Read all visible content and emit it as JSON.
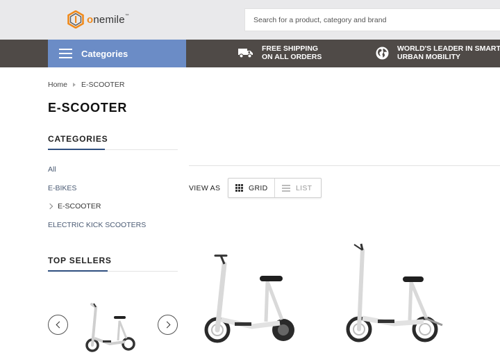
{
  "header": {
    "logo": {
      "text_before": "",
      "o": "o",
      "text_after": "nemile",
      "tm": "™"
    },
    "search": {
      "placeholder": "Search for a product, category and brand",
      "value": ""
    }
  },
  "nav": {
    "categories_label": "Categories",
    "promos": [
      {
        "icon": "truck-icon",
        "line1": "FREE SHIPPING",
        "line2": "ON ALL ORDERS"
      },
      {
        "icon": "globe-icon",
        "line1": "WORLD'S LEADER IN SMART F",
        "line2": "URBAN MOBILITY"
      }
    ]
  },
  "breadcrumb": {
    "home": "Home",
    "current": "E-SCOOTER"
  },
  "page_title": "E-SCOOTER",
  "sidebar": {
    "categories_heading": "CATEGORIES",
    "categories": [
      {
        "label": "All",
        "active": false
      },
      {
        "label": "E-BIKES",
        "active": false
      },
      {
        "label": "E-SCOOTER",
        "active": true
      },
      {
        "label": "ELECTRIC KICK SCOOTERS",
        "active": false
      }
    ],
    "top_sellers_heading": "TOP SELLERS"
  },
  "toolbar": {
    "view_as_label": "VIEW AS",
    "grid_label": "GRID",
    "list_label": "LIST",
    "selected": "grid"
  },
  "colors": {
    "header_bg": "#e9e9eb",
    "navbar_bg": "#4f4a47",
    "categories_bg": "#6b8cc6",
    "accent_underline": "#2f4f7f",
    "logo_orange": "#f08a1c"
  }
}
